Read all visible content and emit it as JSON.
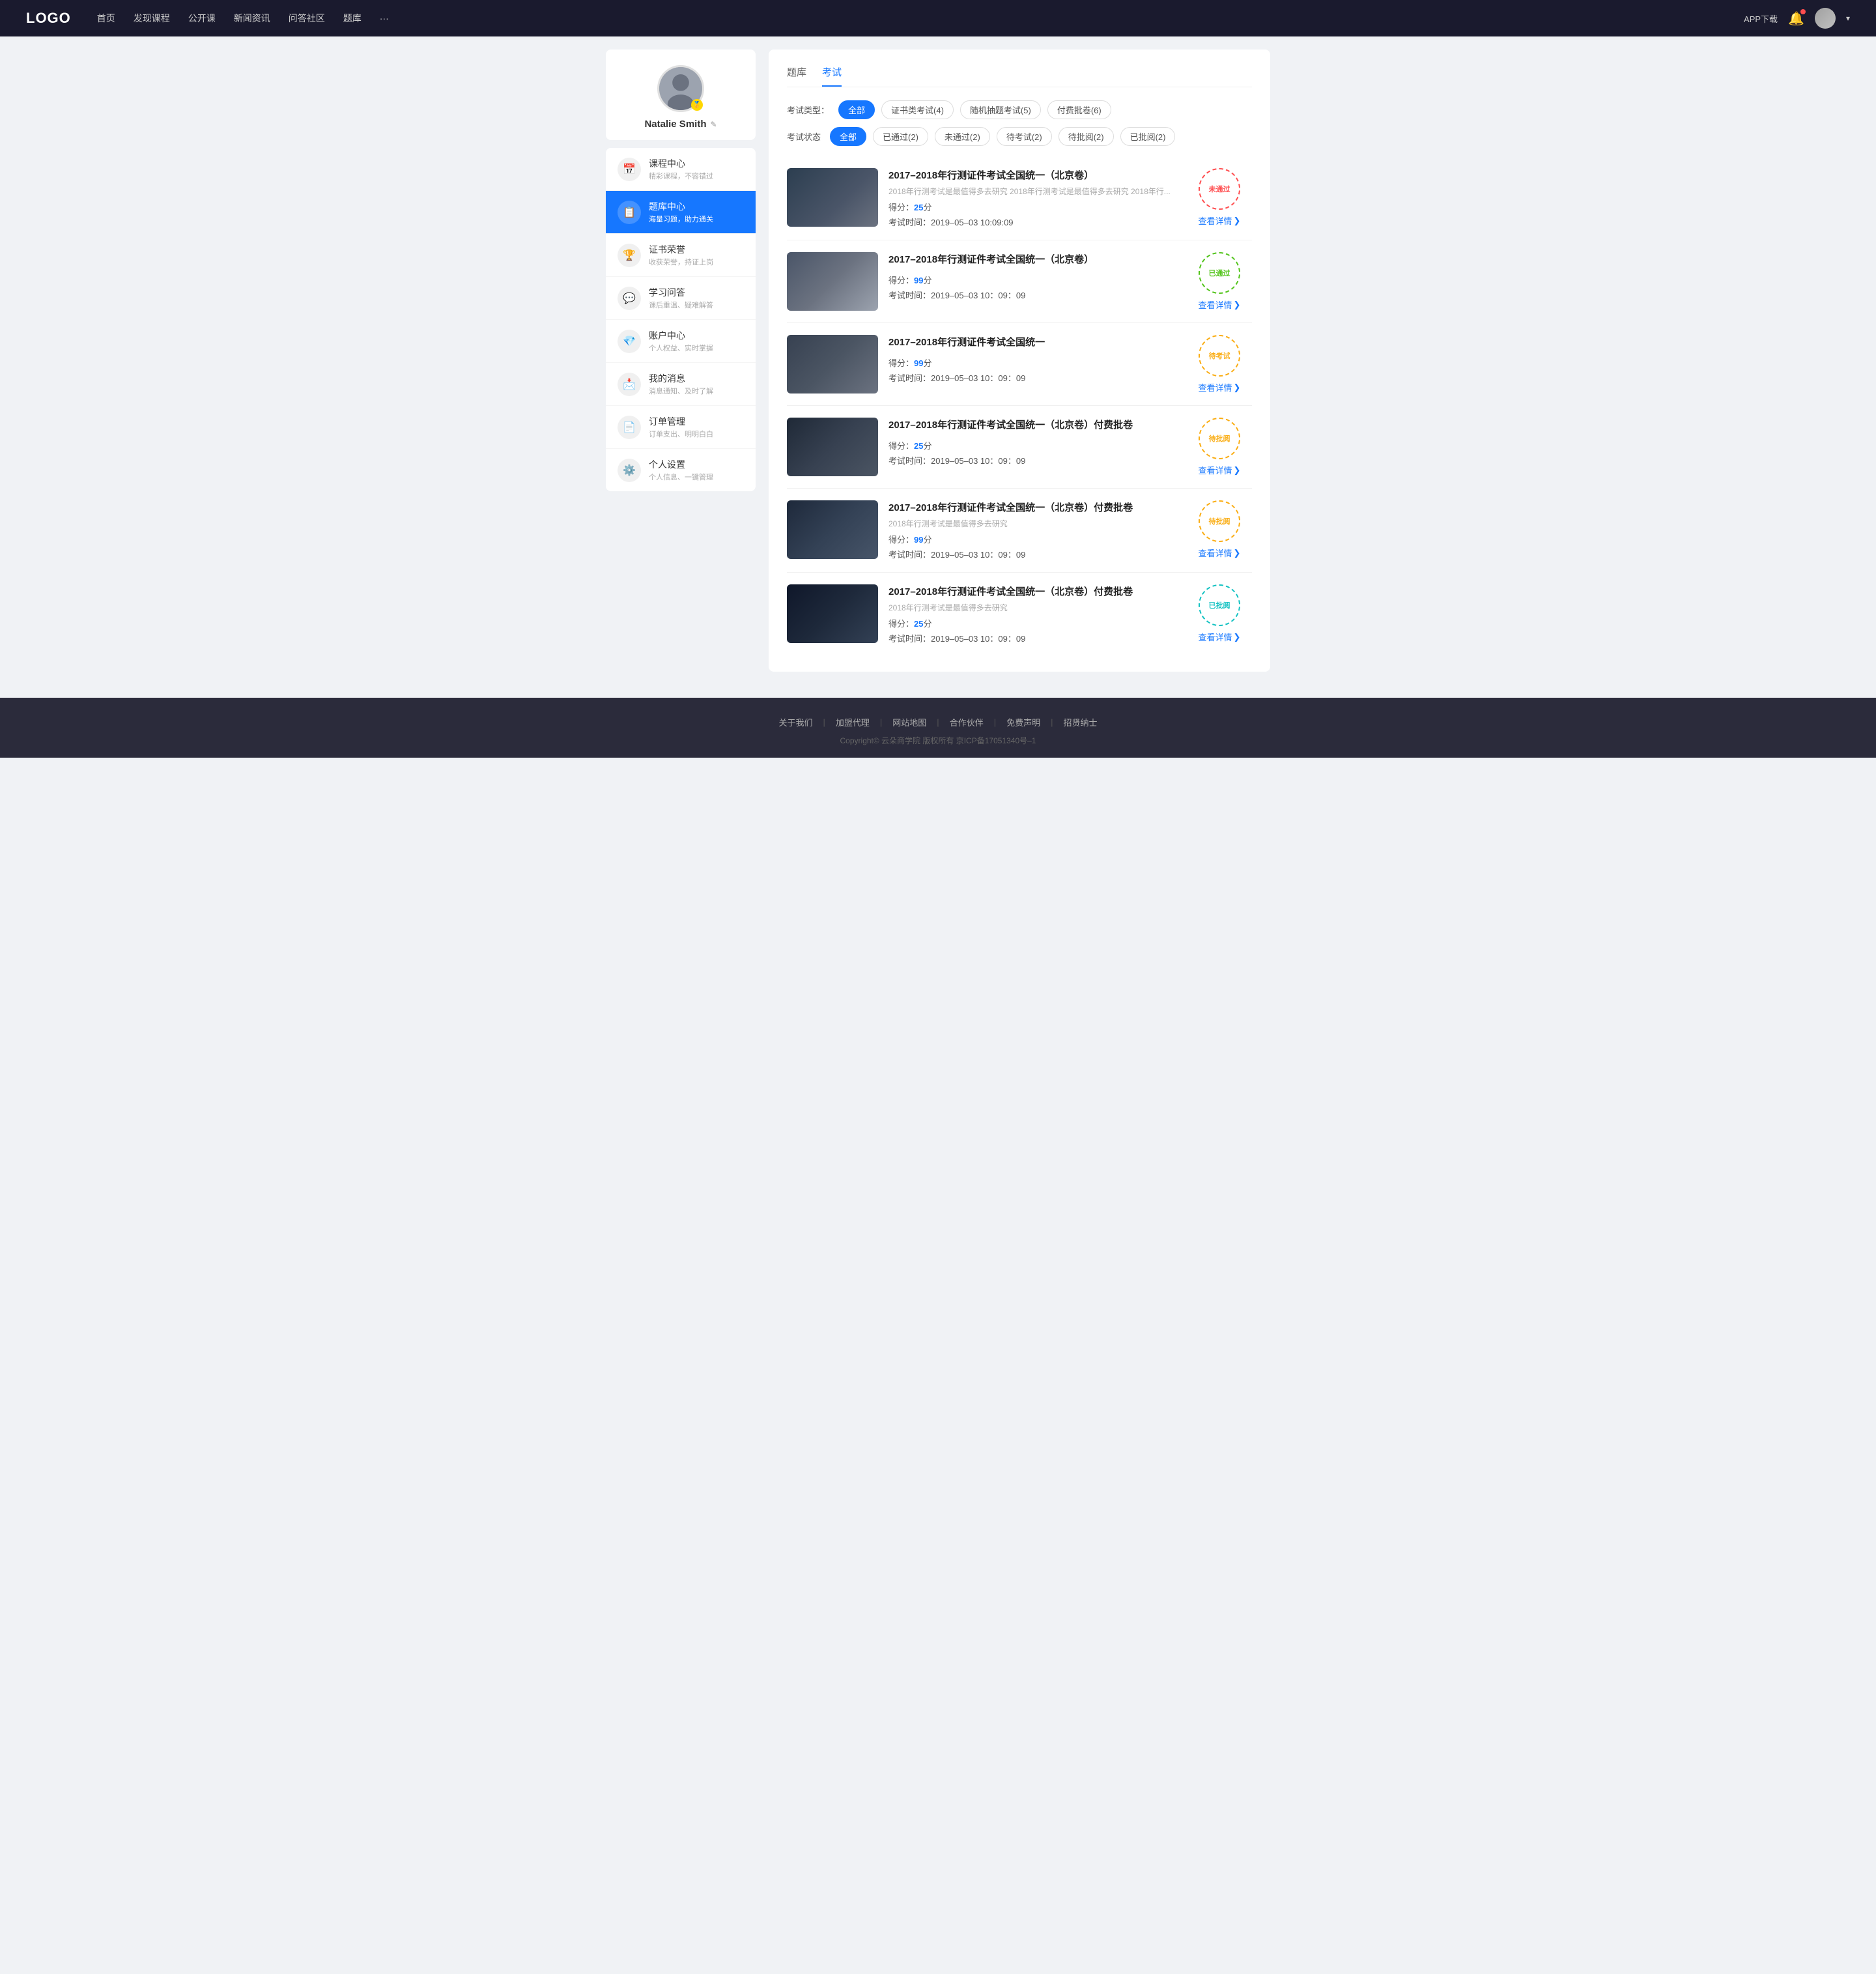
{
  "header": {
    "logo": "LOGO",
    "nav": [
      {
        "label": "首页",
        "id": "home"
      },
      {
        "label": "发现课程",
        "id": "discover"
      },
      {
        "label": "公开课",
        "id": "opencourse"
      },
      {
        "label": "新闻资讯",
        "id": "news"
      },
      {
        "label": "问答社区",
        "id": "qa"
      },
      {
        "label": "题库",
        "id": "quiz"
      },
      {
        "label": "···",
        "id": "more"
      }
    ],
    "app_download": "APP下载",
    "user_arrow": "▾"
  },
  "sidebar": {
    "username": "Natalie Smith",
    "edit_icon": "✎",
    "menu": [
      {
        "icon": "📅",
        "label": "课程中心",
        "sub": "精彩课程，不容错过",
        "id": "course"
      },
      {
        "icon": "📋",
        "label": "题库中心",
        "sub": "海量习题，助力通关",
        "id": "quiz",
        "active": true
      },
      {
        "icon": "🏆",
        "label": "证书荣誉",
        "sub": "收获荣誉，持证上岗",
        "id": "cert"
      },
      {
        "icon": "💬",
        "label": "学习问答",
        "sub": "课后重温、疑难解答",
        "id": "ask"
      },
      {
        "icon": "💎",
        "label": "账户中心",
        "sub": "个人权益、实时掌握",
        "id": "account"
      },
      {
        "icon": "📩",
        "label": "我的消息",
        "sub": "消息通知、及时了解",
        "id": "message"
      },
      {
        "icon": "📄",
        "label": "订单管理",
        "sub": "订单支出、明明白白",
        "id": "order"
      },
      {
        "icon": "⚙️",
        "label": "个人设置",
        "sub": "个人信息、一键管理",
        "id": "settings"
      }
    ]
  },
  "content": {
    "tabs": [
      {
        "label": "题库",
        "id": "bank",
        "active": false
      },
      {
        "label": "考试",
        "id": "exam",
        "active": true
      }
    ],
    "filter_type_label": "考试类型：",
    "filter_types": [
      {
        "label": "全部",
        "active": true
      },
      {
        "label": "证书类考试(4)",
        "active": false
      },
      {
        "label": "随机抽题考试(5)",
        "active": false
      },
      {
        "label": "付费批卷(6)",
        "active": false
      }
    ],
    "filter_status_label": "考试状态",
    "filter_statuses": [
      {
        "label": "全部",
        "active": true
      },
      {
        "label": "已通过(2)",
        "active": false
      },
      {
        "label": "未通过(2)",
        "active": false
      },
      {
        "label": "待考试(2)",
        "active": false
      },
      {
        "label": "待批阅(2)",
        "active": false
      },
      {
        "label": "已批阅(2)",
        "active": false
      }
    ],
    "exams": [
      {
        "id": 1,
        "title": "2017–2018年行测证件考试全国统一（北京卷）",
        "desc": "2018年行测考试是最值得多去研究 2018年行测考试是最值得多去研究 2018年行...",
        "score_label": "得分：",
        "score": "25",
        "score_unit": "分",
        "time_label": "考试时间：",
        "time": "2019–05–03  10:09:09",
        "status": "未通过",
        "stamp_class": "stamp-failed",
        "detail_label": "查看详情",
        "thumb_class": "thumb-1"
      },
      {
        "id": 2,
        "title": "2017–2018年行测证件考试全国统一（北京卷）",
        "desc": "",
        "score_label": "得分：",
        "score": "99",
        "score_unit": "分",
        "time_label": "考试时间：",
        "time": "2019–05–03  10：09：09",
        "status": "已通过",
        "stamp_class": "stamp-passed",
        "detail_label": "查看详情",
        "thumb_class": "thumb-2"
      },
      {
        "id": 3,
        "title": "2017–2018年行测证件考试全国统一",
        "desc": "",
        "score_label": "得分：",
        "score": "99",
        "score_unit": "分",
        "time_label": "考试时间：",
        "time": "2019–05–03  10：09：09",
        "status": "待考试",
        "stamp_class": "stamp-review",
        "detail_label": "查看详情",
        "thumb_class": "thumb-3"
      },
      {
        "id": 4,
        "title": "2017–2018年行测证件考试全国统一（北京卷）付费批卷",
        "desc": "",
        "score_label": "得分：",
        "score": "25",
        "score_unit": "分",
        "time_label": "考试时间：",
        "time": "2019–05–03  10：09：09",
        "status": "待批阅",
        "stamp_class": "stamp-review",
        "detail_label": "查看详情",
        "thumb_class": "thumb-4"
      },
      {
        "id": 5,
        "title": "2017–2018年行测证件考试全国统一（北京卷）付费批卷",
        "desc": "2018年行测考试是最值得多去研究",
        "score_label": "得分：",
        "score": "99",
        "score_unit": "分",
        "time_label": "考试时间：",
        "time": "2019–05–03  10：09：09",
        "status": "待批阅",
        "stamp_class": "stamp-review",
        "detail_label": "查看详情",
        "thumb_class": "thumb-5"
      },
      {
        "id": 6,
        "title": "2017–2018年行测证件考试全国统一（北京卷）付费批卷",
        "desc": "2018年行测考试是最值得多去研究",
        "score_label": "得分：",
        "score": "25",
        "score_unit": "分",
        "time_label": "考试时间：",
        "time": "2019–05–03  10：09：09",
        "status": "已批阅",
        "stamp_class": "stamp-reviewed",
        "detail_label": "查看详情",
        "thumb_class": "thumb-6"
      }
    ]
  },
  "footer": {
    "links": [
      "关于我们",
      "加盟代理",
      "网站地图",
      "合作伙伴",
      "免费声明",
      "招贤纳士"
    ],
    "copyright": "Copyright© 云朵商学院  版权所有    京ICP备17051340号–1"
  }
}
